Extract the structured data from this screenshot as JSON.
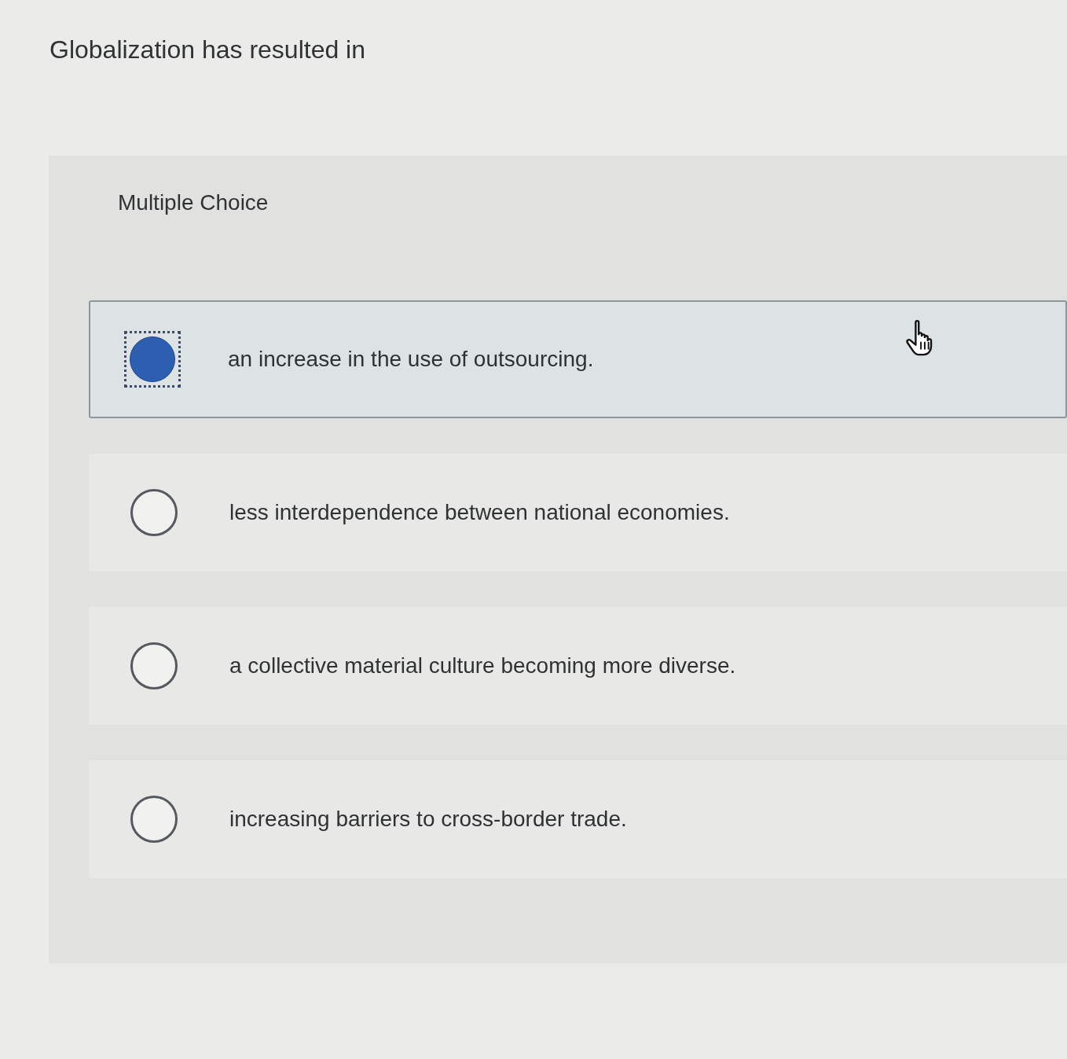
{
  "question": {
    "title": "Globalization has resulted in"
  },
  "answer_panel": {
    "type_label": "Multiple Choice",
    "options": [
      {
        "text": "an increase in the use of outsourcing.",
        "selected": true
      },
      {
        "text": "less interdependence between national economies.",
        "selected": false
      },
      {
        "text": "a collective material culture becoming more diverse.",
        "selected": false
      },
      {
        "text": "increasing barriers to cross-border trade.",
        "selected": false
      }
    ]
  }
}
